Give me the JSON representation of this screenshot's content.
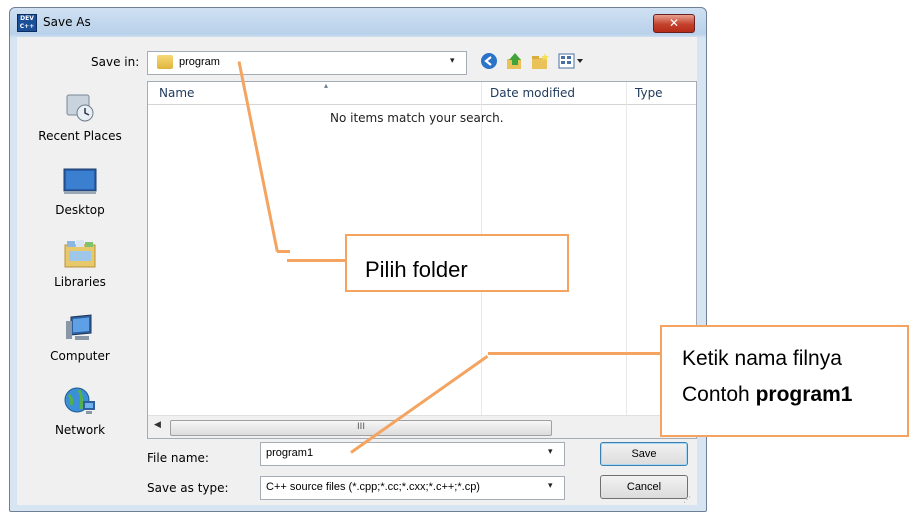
{
  "window": {
    "title": "Save As",
    "icon_label": "DEV C++",
    "close_symbol": "✕"
  },
  "toolbar": {
    "save_in_label": "Save in:",
    "folder": "program",
    "dropdown_arrow": "▾",
    "icons": [
      "back-icon",
      "up-folder-icon",
      "new-folder-icon",
      "views-menu-icon"
    ]
  },
  "places": [
    {
      "label": "Recent Places",
      "icon": "recent-places-icon"
    },
    {
      "label": "Desktop",
      "icon": "desktop-icon"
    },
    {
      "label": "Libraries",
      "icon": "libraries-icon"
    },
    {
      "label": "Computer",
      "icon": "computer-icon"
    },
    {
      "label": "Network",
      "icon": "network-icon"
    }
  ],
  "list": {
    "columns": [
      "Name",
      "Date modified",
      "Type"
    ],
    "empty_message": "No items match your search.",
    "scroll_grip": "III"
  },
  "form": {
    "file_name_label": "File name:",
    "file_name_value": "program1",
    "save_type_label": "Save as type:",
    "save_type_value": "C++ source files (*.cpp;*.cc;*.cxx;*.c++;*.cp)"
  },
  "buttons": {
    "save": "Save",
    "cancel": "Cancel"
  },
  "annotations": {
    "folder_note": "Pilih folder",
    "filename_note_line1": "Ketik nama filnya",
    "filename_note_prefix": "Contoh ",
    "filename_note_bold": "program1"
  },
  "colors": {
    "annotation": "#f4a460",
    "close_button": "#c3412b"
  }
}
